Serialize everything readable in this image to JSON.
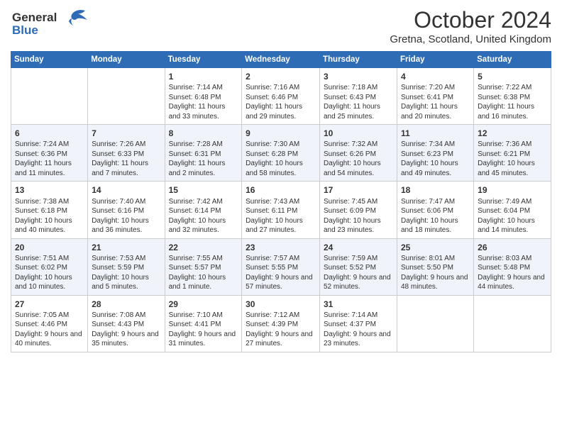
{
  "header": {
    "logo_line1": "General",
    "logo_line2": "Blue",
    "month_title": "October 2024",
    "location": "Gretna, Scotland, United Kingdom"
  },
  "weekdays": [
    "Sunday",
    "Monday",
    "Tuesday",
    "Wednesday",
    "Thursday",
    "Friday",
    "Saturday"
  ],
  "weeks": [
    [
      {
        "day": "",
        "sunrise": "",
        "sunset": "",
        "daylight": ""
      },
      {
        "day": "",
        "sunrise": "",
        "sunset": "",
        "daylight": ""
      },
      {
        "day": "1",
        "sunrise": "Sunrise: 7:14 AM",
        "sunset": "Sunset: 6:48 PM",
        "daylight": "Daylight: 11 hours and 33 minutes."
      },
      {
        "day": "2",
        "sunrise": "Sunrise: 7:16 AM",
        "sunset": "Sunset: 6:46 PM",
        "daylight": "Daylight: 11 hours and 29 minutes."
      },
      {
        "day": "3",
        "sunrise": "Sunrise: 7:18 AM",
        "sunset": "Sunset: 6:43 PM",
        "daylight": "Daylight: 11 hours and 25 minutes."
      },
      {
        "day": "4",
        "sunrise": "Sunrise: 7:20 AM",
        "sunset": "Sunset: 6:41 PM",
        "daylight": "Daylight: 11 hours and 20 minutes."
      },
      {
        "day": "5",
        "sunrise": "Sunrise: 7:22 AM",
        "sunset": "Sunset: 6:38 PM",
        "daylight": "Daylight: 11 hours and 16 minutes."
      }
    ],
    [
      {
        "day": "6",
        "sunrise": "Sunrise: 7:24 AM",
        "sunset": "Sunset: 6:36 PM",
        "daylight": "Daylight: 11 hours and 11 minutes."
      },
      {
        "day": "7",
        "sunrise": "Sunrise: 7:26 AM",
        "sunset": "Sunset: 6:33 PM",
        "daylight": "Daylight: 11 hours and 7 minutes."
      },
      {
        "day": "8",
        "sunrise": "Sunrise: 7:28 AM",
        "sunset": "Sunset: 6:31 PM",
        "daylight": "Daylight: 11 hours and 2 minutes."
      },
      {
        "day": "9",
        "sunrise": "Sunrise: 7:30 AM",
        "sunset": "Sunset: 6:28 PM",
        "daylight": "Daylight: 10 hours and 58 minutes."
      },
      {
        "day": "10",
        "sunrise": "Sunrise: 7:32 AM",
        "sunset": "Sunset: 6:26 PM",
        "daylight": "Daylight: 10 hours and 54 minutes."
      },
      {
        "day": "11",
        "sunrise": "Sunrise: 7:34 AM",
        "sunset": "Sunset: 6:23 PM",
        "daylight": "Daylight: 10 hours and 49 minutes."
      },
      {
        "day": "12",
        "sunrise": "Sunrise: 7:36 AM",
        "sunset": "Sunset: 6:21 PM",
        "daylight": "Daylight: 10 hours and 45 minutes."
      }
    ],
    [
      {
        "day": "13",
        "sunrise": "Sunrise: 7:38 AM",
        "sunset": "Sunset: 6:18 PM",
        "daylight": "Daylight: 10 hours and 40 minutes."
      },
      {
        "day": "14",
        "sunrise": "Sunrise: 7:40 AM",
        "sunset": "Sunset: 6:16 PM",
        "daylight": "Daylight: 10 hours and 36 minutes."
      },
      {
        "day": "15",
        "sunrise": "Sunrise: 7:42 AM",
        "sunset": "Sunset: 6:14 PM",
        "daylight": "Daylight: 10 hours and 32 minutes."
      },
      {
        "day": "16",
        "sunrise": "Sunrise: 7:43 AM",
        "sunset": "Sunset: 6:11 PM",
        "daylight": "Daylight: 10 hours and 27 minutes."
      },
      {
        "day": "17",
        "sunrise": "Sunrise: 7:45 AM",
        "sunset": "Sunset: 6:09 PM",
        "daylight": "Daylight: 10 hours and 23 minutes."
      },
      {
        "day": "18",
        "sunrise": "Sunrise: 7:47 AM",
        "sunset": "Sunset: 6:06 PM",
        "daylight": "Daylight: 10 hours and 18 minutes."
      },
      {
        "day": "19",
        "sunrise": "Sunrise: 7:49 AM",
        "sunset": "Sunset: 6:04 PM",
        "daylight": "Daylight: 10 hours and 14 minutes."
      }
    ],
    [
      {
        "day": "20",
        "sunrise": "Sunrise: 7:51 AM",
        "sunset": "Sunset: 6:02 PM",
        "daylight": "Daylight: 10 hours and 10 minutes."
      },
      {
        "day": "21",
        "sunrise": "Sunrise: 7:53 AM",
        "sunset": "Sunset: 5:59 PM",
        "daylight": "Daylight: 10 hours and 5 minutes."
      },
      {
        "day": "22",
        "sunrise": "Sunrise: 7:55 AM",
        "sunset": "Sunset: 5:57 PM",
        "daylight": "Daylight: 10 hours and 1 minute."
      },
      {
        "day": "23",
        "sunrise": "Sunrise: 7:57 AM",
        "sunset": "Sunset: 5:55 PM",
        "daylight": "Daylight: 9 hours and 57 minutes."
      },
      {
        "day": "24",
        "sunrise": "Sunrise: 7:59 AM",
        "sunset": "Sunset: 5:52 PM",
        "daylight": "Daylight: 9 hours and 52 minutes."
      },
      {
        "day": "25",
        "sunrise": "Sunrise: 8:01 AM",
        "sunset": "Sunset: 5:50 PM",
        "daylight": "Daylight: 9 hours and 48 minutes."
      },
      {
        "day": "26",
        "sunrise": "Sunrise: 8:03 AM",
        "sunset": "Sunset: 5:48 PM",
        "daylight": "Daylight: 9 hours and 44 minutes."
      }
    ],
    [
      {
        "day": "27",
        "sunrise": "Sunrise: 7:05 AM",
        "sunset": "Sunset: 4:46 PM",
        "daylight": "Daylight: 9 hours and 40 minutes."
      },
      {
        "day": "28",
        "sunrise": "Sunrise: 7:08 AM",
        "sunset": "Sunset: 4:43 PM",
        "daylight": "Daylight: 9 hours and 35 minutes."
      },
      {
        "day": "29",
        "sunrise": "Sunrise: 7:10 AM",
        "sunset": "Sunset: 4:41 PM",
        "daylight": "Daylight: 9 hours and 31 minutes."
      },
      {
        "day": "30",
        "sunrise": "Sunrise: 7:12 AM",
        "sunset": "Sunset: 4:39 PM",
        "daylight": "Daylight: 9 hours and 27 minutes."
      },
      {
        "day": "31",
        "sunrise": "Sunrise: 7:14 AM",
        "sunset": "Sunset: 4:37 PM",
        "daylight": "Daylight: 9 hours and 23 minutes."
      },
      {
        "day": "",
        "sunrise": "",
        "sunset": "",
        "daylight": ""
      },
      {
        "day": "",
        "sunrise": "",
        "sunset": "",
        "daylight": ""
      }
    ]
  ]
}
